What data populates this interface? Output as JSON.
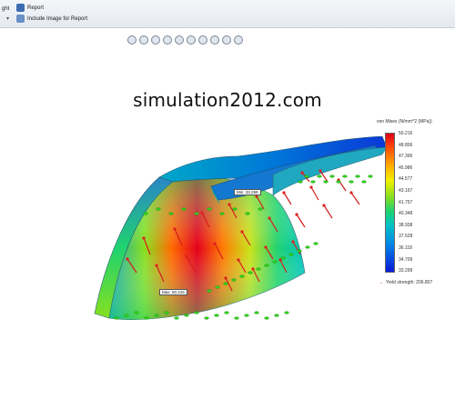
{
  "toolbar": {
    "items": [
      {
        "label": "ght",
        "icon": "partial-icon"
      },
      {
        "label": "Report",
        "icon": "report-icon"
      },
      {
        "label": "Include Image for Report",
        "icon": "image-icon"
      }
    ]
  },
  "watermark": "simulation2012.com",
  "legend": {
    "title": "von Mises (N/mm^2 (MPa))",
    "ticks": [
      "50.216",
      "48.806",
      "47.396",
      "45.986",
      "44.577",
      "43.167",
      "41.757",
      "40.348",
      "38.938",
      "37.528",
      "36.118",
      "34.709",
      "33.299"
    ],
    "colors": [
      "#e3001a",
      "#ff5a00",
      "#ffb000",
      "#f2f000",
      "#86e01f",
      "#1fd36f",
      "#00c4c4",
      "#0087e8",
      "#0a18d8"
    ],
    "yield_label": "Yield strength: 206.807"
  },
  "probes": {
    "min_label": "Min: 33.299",
    "max_label": "Max: 50.216"
  }
}
